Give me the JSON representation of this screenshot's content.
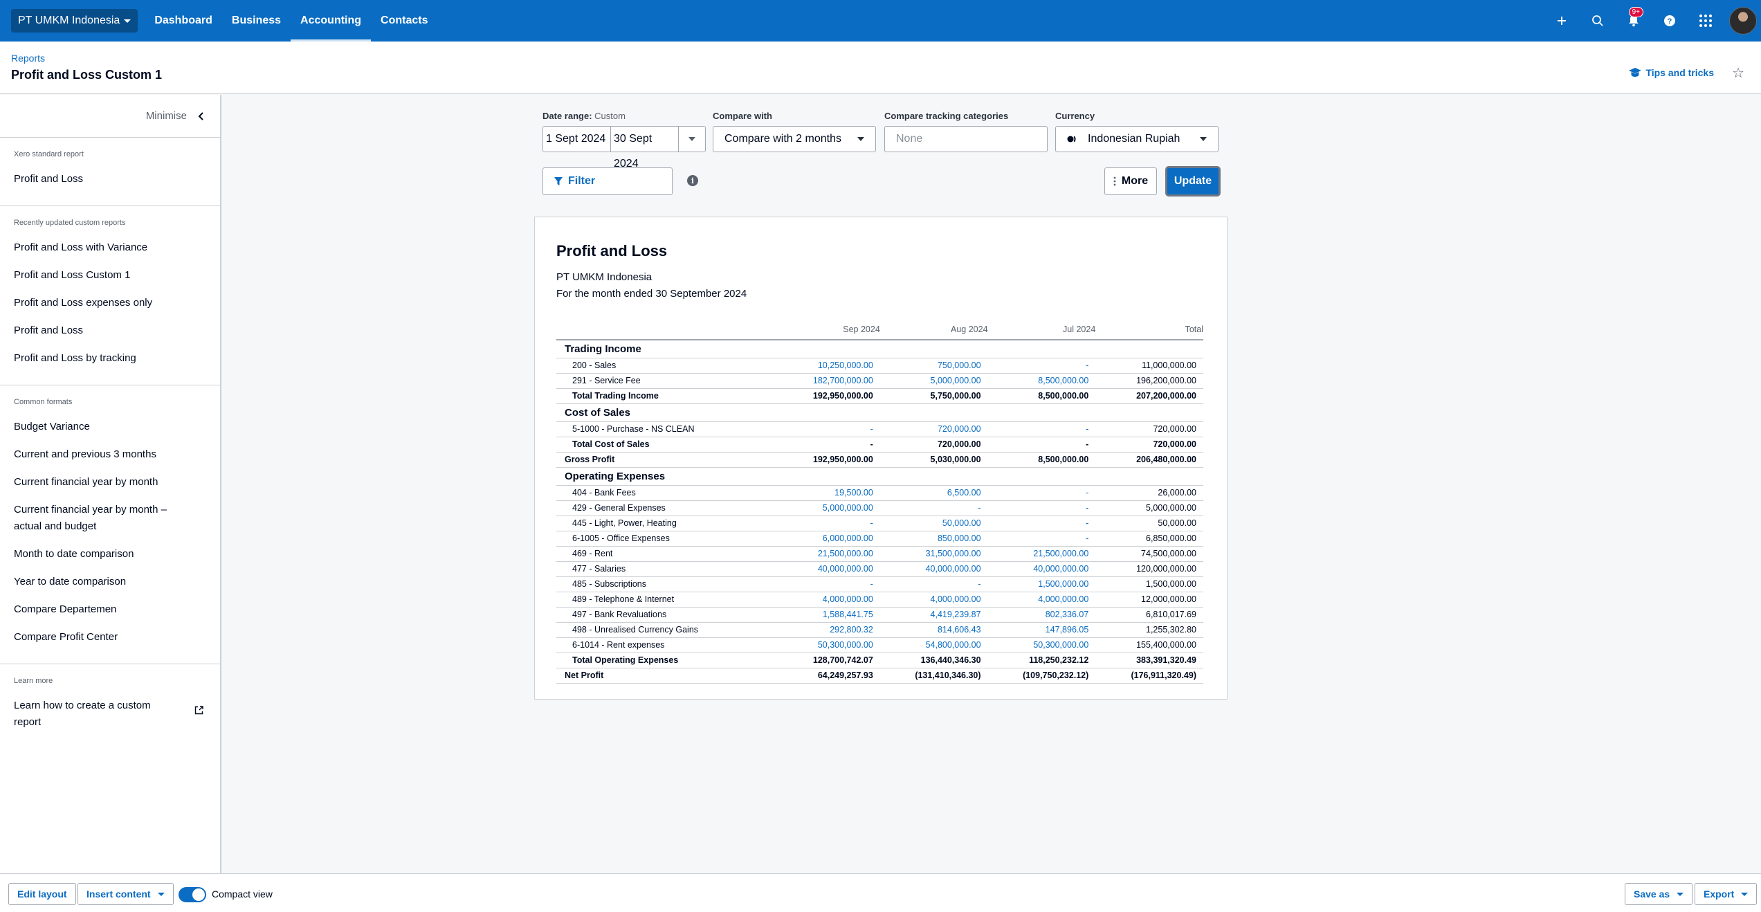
{
  "topnav": {
    "org_name": "PT UMKM Indonesia",
    "tabs": [
      {
        "label": "Dashboard",
        "active": false
      },
      {
        "label": "Business",
        "active": false
      },
      {
        "label": "Accounting",
        "active": true
      },
      {
        "label": "Contacts",
        "active": false
      }
    ],
    "icons": [
      "plus-icon",
      "search-icon",
      "bell-icon",
      "help-icon",
      "apps-grid-icon"
    ],
    "notification_badge": "9+",
    "accent_color": "#0a6cc2"
  },
  "header": {
    "breadcrumb": "Reports",
    "title": "Profit and Loss Custom 1",
    "tips_label": "Tips and tricks"
  },
  "sidebar": {
    "minimise_label": "Minimise",
    "sections": [
      {
        "heading": "Xero standard report",
        "items": [
          "Profit and Loss"
        ]
      },
      {
        "heading": "Recently updated custom reports",
        "items": [
          "Profit and Loss with Variance",
          "Profit and Loss Custom 1",
          "Profit and Loss expenses only",
          "Profit and Loss",
          "Profit and Loss by tracking"
        ]
      },
      {
        "heading": "Common formats",
        "items": [
          "Budget Variance",
          "Current and previous 3 months",
          "Current financial year by month",
          "Current financial year by month – actual and budget",
          "Month to date comparison",
          "Year to date comparison",
          "Compare Departemen",
          "Compare Profit Center"
        ]
      },
      {
        "heading": "Learn more",
        "items": [
          "Learn how to create a custom report"
        ]
      }
    ]
  },
  "controls": {
    "date_range_label": "Date range:",
    "date_range_type": "Custom",
    "date_from": "1 Sept 2024",
    "date_to": "30 Sept 2024",
    "compare_with_label": "Compare with",
    "compare_with_value": "Compare with 2 months",
    "tracking_label": "Compare tracking categories",
    "tracking_placeholder": "None",
    "currency_label": "Currency",
    "currency_value": "Indonesian Rupiah",
    "filter_label": "Filter",
    "more_label": "More",
    "update_label": "Update"
  },
  "report": {
    "title": "Profit and Loss",
    "org": "PT UMKM Indonesia",
    "period": "For the month ended 30 September 2024",
    "columns": [
      "Sep 2024",
      "Aug 2024",
      "Jul 2024",
      "Total"
    ],
    "sections": [
      {
        "heading": "Trading Income",
        "rows": [
          {
            "name": "200 - Sales",
            "values": [
              "10,250,000.00",
              "750,000.00",
              "-",
              "11,000,000.00"
            ]
          },
          {
            "name": "291 - Service Fee",
            "values": [
              "182,700,000.00",
              "5,000,000.00",
              "8,500,000.00",
              "196,200,000.00"
            ]
          }
        ],
        "total": {
          "name": "Total Trading Income",
          "values": [
            "192,950,000.00",
            "5,750,000.00",
            "8,500,000.00",
            "207,200,000.00"
          ]
        }
      },
      {
        "heading": "Cost of Sales",
        "rows": [
          {
            "name": "5-1000 - Purchase - NS CLEAN",
            "values": [
              "-",
              "720,000.00",
              "-",
              "720,000.00"
            ]
          }
        ],
        "total": {
          "name": "Total Cost of Sales",
          "values": [
            "-",
            "720,000.00",
            "-",
            "720,000.00"
          ]
        }
      }
    ],
    "gross_profit": {
      "name": "Gross Profit",
      "values": [
        "192,950,000.00",
        "5,030,000.00",
        "8,500,000.00",
        "206,480,000.00"
      ]
    },
    "opex": {
      "heading": "Operating Expenses",
      "rows": [
        {
          "name": "404 - Bank Fees",
          "values": [
            "19,500.00",
            "6,500.00",
            "-",
            "26,000.00"
          ]
        },
        {
          "name": "429 - General Expenses",
          "values": [
            "5,000,000.00",
            "-",
            "-",
            "5,000,000.00"
          ]
        },
        {
          "name": "445 - Light, Power, Heating",
          "values": [
            "-",
            "50,000.00",
            "-",
            "50,000.00"
          ]
        },
        {
          "name": "6-1005 - Office Expenses",
          "values": [
            "6,000,000.00",
            "850,000.00",
            "-",
            "6,850,000.00"
          ]
        },
        {
          "name": "469 - Rent",
          "values": [
            "21,500,000.00",
            "31,500,000.00",
            "21,500,000.00",
            "74,500,000.00"
          ]
        },
        {
          "name": "477 - Salaries",
          "values": [
            "40,000,000.00",
            "40,000,000.00",
            "40,000,000.00",
            "120,000,000.00"
          ]
        },
        {
          "name": "485 - Subscriptions",
          "values": [
            "-",
            "-",
            "1,500,000.00",
            "1,500,000.00"
          ]
        },
        {
          "name": "489 - Telephone & Internet",
          "values": [
            "4,000,000.00",
            "4,000,000.00",
            "4,000,000.00",
            "12,000,000.00"
          ]
        },
        {
          "name": "497 - Bank Revaluations",
          "values": [
            "1,588,441.75",
            "4,419,239.87",
            "802,336.07",
            "6,810,017.69"
          ]
        },
        {
          "name": "498 - Unrealised Currency Gains",
          "values": [
            "292,800.32",
            "814,606.43",
            "147,896.05",
            "1,255,302.80"
          ]
        },
        {
          "name": "6-1014 - Rent expenses",
          "values": [
            "50,300,000.00",
            "54,800,000.00",
            "50,300,000.00",
            "155,400,000.00"
          ]
        }
      ],
      "total": {
        "name": "Total Operating Expenses",
        "values": [
          "128,700,742.07",
          "136,440,346.30",
          "118,250,232.12",
          "383,391,320.49"
        ]
      }
    },
    "net_profit": {
      "name": "Net Profit",
      "values": [
        "64,249,257.93",
        "(131,410,346.30)",
        "(109,750,232.12)",
        "(176,911,320.49)"
      ]
    }
  },
  "footer": {
    "edit_layout": "Edit layout",
    "insert_content": "Insert content",
    "compact_view_label": "Compact view",
    "compact_view_on": true,
    "save_as": "Save as",
    "export": "Export"
  }
}
